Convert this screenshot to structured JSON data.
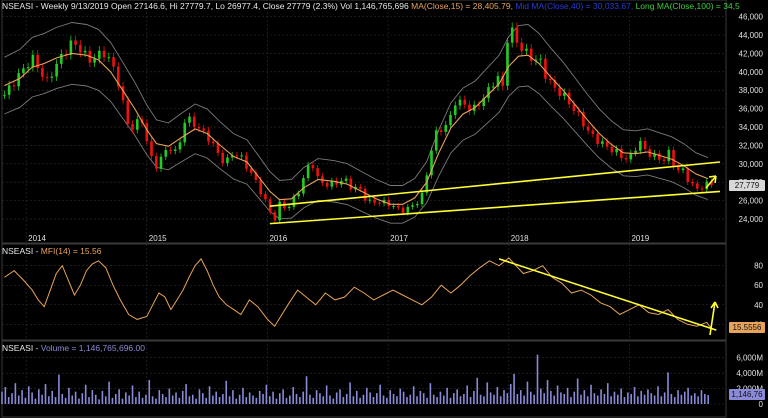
{
  "panels": {
    "price": {
      "symbol": "NSEASI",
      "info": "Weekly 9/13/2019 Open 27146.6, Hi 27779.7, Lo 26977.4, Close 27779 (2.3%) Vol 1,146,765,696",
      "ma_short": "MA(Close,15) = 28,405.79,",
      "ma_mid": "Mid MA(Close,40) = 30,033.67,",
      "ma_long": "Long MA(Close,100) = 34,5",
      "last_tag": "27,779"
    },
    "mfi": {
      "symbol": "NSEASI",
      "label": "MFI(14) = 15.56",
      "last_tag": "15.5556"
    },
    "volume": {
      "symbol": "NSEASI",
      "label": "Volume = 1,146,765,696.00",
      "last_tag": "1,146,76"
    }
  },
  "colors": {
    "up": "#22cc22",
    "down": "#ee1111",
    "ma": "#e8a35a",
    "band": "#7a7a7a",
    "trendline": "#ffff33",
    "mfi": "#e8a35a",
    "volume": "#8a8ad8",
    "grid": "#2f2f2f"
  },
  "chart_data": [
    {
      "type": "candlestick",
      "title": "NSEASI - Weekly 9/13/2019 Open 27146.6, Hi 27779.7, Lo 26977.4, Close 27779 (2.3%) Vol 1,146,765,696",
      "x_tick_labels": [
        "2014",
        "2015",
        "2016",
        "2017",
        "2018",
        "2019"
      ],
      "y_tick_labels": [
        "24,000",
        "26,000",
        "28,000",
        "30,000",
        "32,000",
        "34,000",
        "36,000",
        "38,000",
        "40,000",
        "42,000",
        "44,000",
        "46,000"
      ],
      "y_ticks": [
        24000,
        26000,
        28000,
        30000,
        32000,
        34000,
        36000,
        38000,
        40000,
        42000,
        44000,
        46000
      ],
      "ylim": [
        22700,
        46500
      ],
      "xlim": [
        2013.8,
        2019.8
      ],
      "close_series": [
        [
          2013.82,
          37500
        ],
        [
          2013.95,
          39800
        ],
        [
          2014.05,
          41500
        ],
        [
          2014.1,
          40500
        ],
        [
          2014.17,
          38800
        ],
        [
          2014.23,
          40300
        ],
        [
          2014.3,
          41800
        ],
        [
          2014.38,
          43200
        ],
        [
          2014.45,
          42500
        ],
        [
          2014.52,
          41200
        ],
        [
          2014.6,
          41800
        ],
        [
          2014.66,
          42100
        ],
        [
          2014.72,
          40500
        ],
        [
          2014.78,
          38300
        ],
        [
          2014.83,
          34500
        ],
        [
          2014.9,
          33800
        ],
        [
          2014.95,
          35300
        ],
        [
          2015.0,
          32500
        ],
        [
          2015.06,
          29500
        ],
        [
          2015.1,
          30200
        ],
        [
          2015.15,
          31300
        ],
        [
          2015.2,
          31800
        ],
        [
          2015.25,
          31000
        ],
        [
          2015.32,
          35000
        ],
        [
          2015.38,
          34500
        ],
        [
          2015.45,
          33600
        ],
        [
          2015.52,
          32700
        ],
        [
          2015.58,
          31300
        ],
        [
          2015.65,
          30000
        ],
        [
          2015.72,
          31300
        ],
        [
          2015.78,
          30700
        ],
        [
          2015.85,
          29300
        ],
        [
          2015.92,
          27700
        ],
        [
          2015.97,
          26300
        ],
        [
          2016.02,
          24800
        ],
        [
          2016.06,
          24000
        ],
        [
          2016.1,
          25600
        ],
        [
          2016.17,
          25200
        ],
        [
          2016.25,
          26800
        ],
        [
          2016.3,
          28400
        ],
        [
          2016.36,
          30500
        ],
        [
          2016.42,
          28200
        ],
        [
          2016.5,
          27700
        ],
        [
          2016.58,
          28000
        ],
        [
          2016.64,
          28300
        ],
        [
          2016.7,
          27400
        ],
        [
          2016.77,
          27200
        ],
        [
          2016.83,
          25800
        ],
        [
          2016.9,
          25900
        ],
        [
          2016.96,
          25800
        ],
        [
          2017.02,
          25600
        ],
        [
          2017.1,
          24900
        ],
        [
          2017.16,
          25100
        ],
        [
          2017.23,
          25700
        ],
        [
          2017.28,
          26500
        ],
        [
          2017.33,
          29500
        ],
        [
          2017.38,
          33000
        ],
        [
          2017.45,
          34000
        ],
        [
          2017.5,
          34200
        ],
        [
          2017.55,
          36800
        ],
        [
          2017.63,
          36500
        ],
        [
          2017.7,
          35800
        ],
        [
          2017.77,
          36800
        ],
        [
          2017.85,
          38300
        ],
        [
          2017.9,
          39600
        ],
        [
          2017.95,
          38300
        ],
        [
          2018.0,
          45200
        ],
        [
          2018.03,
          44300
        ],
        [
          2018.07,
          43200
        ],
        [
          2018.13,
          42200
        ],
        [
          2018.2,
          41400
        ],
        [
          2018.26,
          41200
        ],
        [
          2018.31,
          39500
        ],
        [
          2018.37,
          38300
        ],
        [
          2018.45,
          37500
        ],
        [
          2018.52,
          36300
        ],
        [
          2018.6,
          34800
        ],
        [
          2018.67,
          33300
        ],
        [
          2018.75,
          32400
        ],
        [
          2018.82,
          31800
        ],
        [
          2018.9,
          31200
        ],
        [
          2018.96,
          30500
        ],
        [
          2019.02,
          30900
        ],
        [
          2019.08,
          32600
        ],
        [
          2019.13,
          31400
        ],
        [
          2019.2,
          30900
        ],
        [
          2019.27,
          30300
        ],
        [
          2019.33,
          31200
        ],
        [
          2019.38,
          29400
        ],
        [
          2019.44,
          29300
        ],
        [
          2019.5,
          28000
        ],
        [
          2019.57,
          27100
        ],
        [
          2019.62,
          27800
        ],
        [
          2019.68,
          27779
        ]
      ],
      "ma_series": [
        [
          2013.82,
          38500
        ],
        [
          2013.95,
          39300
        ],
        [
          2014.05,
          40500
        ],
        [
          2014.15,
          40900
        ],
        [
          2014.25,
          41500
        ],
        [
          2014.38,
          42000
        ],
        [
          2014.5,
          41800
        ],
        [
          2014.6,
          41300
        ],
        [
          2014.7,
          40000
        ],
        [
          2014.8,
          38000
        ],
        [
          2014.9,
          36000
        ],
        [
          2015.0,
          33700
        ],
        [
          2015.08,
          32200
        ],
        [
          2015.18,
          31900
        ],
        [
          2015.28,
          32800
        ],
        [
          2015.4,
          33800
        ],
        [
          2015.5,
          33300
        ],
        [
          2015.6,
          32100
        ],
        [
          2015.72,
          30800
        ],
        [
          2015.83,
          30200
        ],
        [
          2015.92,
          28700
        ],
        [
          2016.02,
          27000
        ],
        [
          2016.1,
          26100
        ],
        [
          2016.2,
          26200
        ],
        [
          2016.3,
          27400
        ],
        [
          2016.42,
          28300
        ],
        [
          2016.55,
          28100
        ],
        [
          2016.66,
          27800
        ],
        [
          2016.78,
          27000
        ],
        [
          2016.9,
          26200
        ],
        [
          2017.02,
          25600
        ],
        [
          2017.12,
          25600
        ],
        [
          2017.22,
          26300
        ],
        [
          2017.32,
          28000
        ],
        [
          2017.42,
          31200
        ],
        [
          2017.52,
          33900
        ],
        [
          2017.62,
          35400
        ],
        [
          2017.72,
          36100
        ],
        [
          2017.82,
          37400
        ],
        [
          2017.92,
          38700
        ],
        [
          2018.0,
          40600
        ],
        [
          2018.08,
          41700
        ],
        [
          2018.16,
          41800
        ],
        [
          2018.25,
          40900
        ],
        [
          2018.35,
          39400
        ],
        [
          2018.45,
          38000
        ],
        [
          2018.55,
          36400
        ],
        [
          2018.65,
          34800
        ],
        [
          2018.75,
          33300
        ],
        [
          2018.85,
          32100
        ],
        [
          2018.95,
          31200
        ],
        [
          2019.05,
          31100
        ],
        [
          2019.15,
          31300
        ],
        [
          2019.25,
          30900
        ],
        [
          2019.35,
          30500
        ],
        [
          2019.45,
          29800
        ],
        [
          2019.55,
          28900
        ],
        [
          2019.65,
          28400
        ]
      ],
      "trendlines": [
        {
          "points": [
            [
              2016.02,
              25400
            ],
            [
              2019.75,
              30200
            ]
          ]
        },
        {
          "points": [
            [
              2016.02,
              23500
            ],
            [
              2019.75,
              27000
            ]
          ]
        }
      ]
    },
    {
      "type": "line",
      "title": "NSEASI - MFI(14) = 15.56",
      "y_tick_labels": [
        "20",
        "40",
        "60",
        "80"
      ],
      "y_ticks": [
        20,
        40,
        60,
        80
      ],
      "ylim": [
        8,
        92
      ],
      "x": [
        2013.82,
        2013.9,
        2013.98,
        2014.05,
        2014.1,
        2014.15,
        2014.2,
        2014.25,
        2014.3,
        2014.35,
        2014.4,
        2014.45,
        2014.5,
        2014.55,
        2014.6,
        2014.66,
        2014.72,
        2014.78,
        2014.85,
        2014.92,
        2015.0,
        2015.05,
        2015.1,
        2015.15,
        2015.2,
        2015.25,
        2015.3,
        2015.35,
        2015.4,
        2015.45,
        2015.5,
        2015.55,
        2015.6,
        2015.66,
        2015.72,
        2015.78,
        2015.85,
        2015.92,
        2016.0,
        2016.06,
        2016.12,
        2016.18,
        2016.25,
        2016.32,
        2016.4,
        2016.48,
        2016.56,
        2016.64,
        2016.72,
        2016.8,
        2016.88,
        2016.96,
        2017.04,
        2017.12,
        2017.2,
        2017.28,
        2017.36,
        2017.44,
        2017.52,
        2017.6,
        2017.68,
        2017.76,
        2017.84,
        2017.92,
        2018.0,
        2018.06,
        2018.12,
        2018.2,
        2018.28,
        2018.36,
        2018.44,
        2018.52,
        2018.6,
        2018.68,
        2018.76,
        2018.84,
        2018.92,
        2019.0,
        2019.08,
        2019.16,
        2019.24,
        2019.32,
        2019.4,
        2019.48,
        2019.56,
        2019.64,
        2019.68
      ],
      "y": [
        68,
        75,
        65,
        55,
        45,
        38,
        55,
        72,
        80,
        65,
        50,
        60,
        75,
        82,
        85,
        78,
        60,
        45,
        30,
        25,
        28,
        40,
        52,
        48,
        35,
        45,
        55,
        68,
        80,
        87,
        75,
        60,
        48,
        40,
        35,
        30,
        45,
        38,
        25,
        18,
        30,
        42,
        55,
        48,
        40,
        52,
        45,
        48,
        58,
        52,
        45,
        50,
        55,
        50,
        45,
        40,
        48,
        60,
        52,
        60,
        70,
        78,
        85,
        80,
        88,
        80,
        72,
        75,
        80,
        68,
        62,
        52,
        55,
        50,
        42,
        38,
        30,
        35,
        40,
        32,
        30,
        35,
        25,
        20,
        18,
        22,
        15.56
      ],
      "trendlines": [
        {
          "points": [
            [
              2017.92,
              87
            ],
            [
              2019.72,
              14
            ]
          ]
        }
      ]
    },
    {
      "type": "bar",
      "title": "NSEASI - Volume = 1,146,765,696.00",
      "y_tick_labels": [
        "0",
        "2,000M",
        "4,000M",
        "6,000M"
      ],
      "y_ticks": [
        0,
        2000,
        4000,
        6000
      ],
      "ylim": [
        0,
        7000
      ],
      "units": "M",
      "x_start": 2013.8,
      "x_step": 0.02,
      "values": [
        1600,
        2200,
        900,
        1400,
        2700,
        1100,
        1800,
        800,
        2300,
        1500,
        700,
        1900,
        1200,
        2600,
        1000,
        1700,
        900,
        3800,
        1300,
        800,
        2100,
        1100,
        1600,
        700,
        1400,
        2500,
        900,
        1800,
        1200,
        600,
        1700,
        1000,
        2900,
        800,
        1300,
        1900,
        700,
        1500,
        1100,
        2400,
        900,
        1600,
        800,
        1200,
        3100,
        1000,
        700,
        1800,
        1300,
        900,
        2000,
        1100,
        1500,
        800,
        1700,
        2600,
        1000,
        1200,
        700,
        1900,
        1400,
        800,
        2300,
        1100,
        1600,
        900,
        1300,
        3000,
        1000,
        1800,
        700,
        1200,
        2100,
        900,
        1500,
        1100,
        800,
        1700,
        1300,
        2500,
        1000,
        1600,
        700,
        1400,
        1900,
        800,
        1100,
        2200,
        1300,
        900,
        1600,
        3600,
        1200,
        800,
        1800,
        1400,
        1000,
        2400,
        1100,
        700,
        1500,
        1900,
        900,
        1300,
        2800,
        1000,
        1700,
        800,
        1200,
        2100,
        1500,
        900,
        1400,
        2500,
        1100,
        800,
        1800,
        1300,
        1000,
        2000,
        1600,
        900,
        1200,
        2300,
        1000,
        1700,
        1400,
        800,
        2700,
        1200,
        900,
        1600,
        1100,
        2100,
        800,
        1400,
        1900,
        1000,
        1300,
        2400,
        900,
        1700,
        3400,
        1200,
        1000,
        2800,
        1500,
        1200,
        2200,
        1000,
        1800,
        1400,
        2600,
        3900,
        1300,
        1800,
        1100,
        2900,
        1600,
        1200,
        6400,
        2000,
        1400,
        3100,
        1700,
        1100,
        2400,
        1500,
        1300,
        2100,
        900,
        1600,
        3300,
        1200,
        1800,
        1000,
        2500,
        1400,
        1100,
        1900,
        1300,
        2700,
        1000,
        1600,
        1200,
        2000,
        900,
        1500,
        1300,
        2200,
        1000,
        1700,
        1200,
        1900,
        1400,
        1100,
        2300,
        1000,
        1500,
        4100,
        1300,
        900,
        1800,
        1200,
        1600,
        2100,
        1100,
        1400,
        1000,
        1800,
        1300,
        1147
      ]
    }
  ]
}
